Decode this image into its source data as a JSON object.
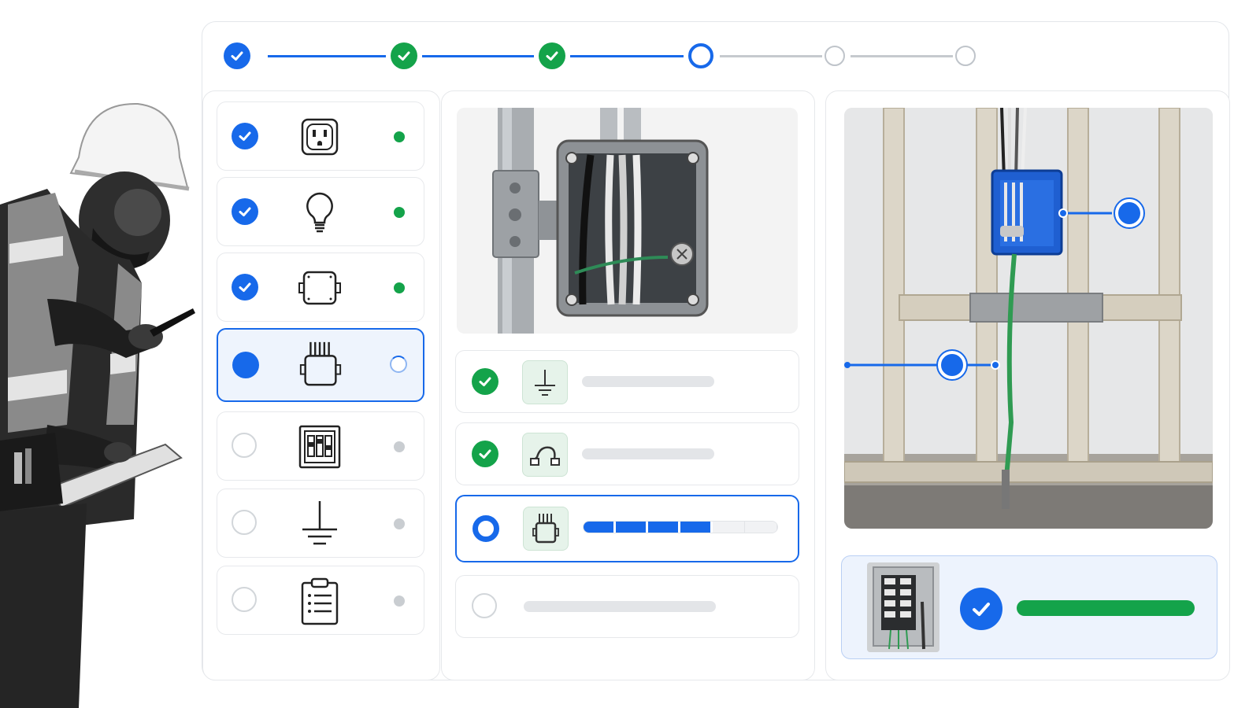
{
  "stepper": {
    "steps": [
      {
        "state": "complete",
        "color": "#1769ea"
      },
      {
        "state": "complete",
        "color": "#14a34a"
      },
      {
        "state": "complete",
        "color": "#14a34a"
      },
      {
        "state": "current",
        "color": "#1769ea"
      },
      {
        "state": "upcoming",
        "color": "#bfc4ca"
      },
      {
        "state": "upcoming",
        "color": "#bfc4ca"
      }
    ]
  },
  "task_list": {
    "items": [
      {
        "icon": "outlet-icon",
        "checked": true,
        "status": "complete"
      },
      {
        "icon": "light-bulb-icon",
        "checked": true,
        "status": "complete"
      },
      {
        "icon": "junction-box-icon",
        "checked": true,
        "status": "complete"
      },
      {
        "icon": "junction-box-wires-icon",
        "checked": false,
        "status": "in-progress",
        "selected": true
      },
      {
        "icon": "breaker-panel-icon",
        "checked": false,
        "status": "pending"
      },
      {
        "icon": "ground-icon",
        "checked": false,
        "status": "pending"
      },
      {
        "icon": "clipboard-icon",
        "checked": false,
        "status": "pending"
      }
    ]
  },
  "checklist": {
    "items": [
      {
        "icon": "ground-icon",
        "state": "complete"
      },
      {
        "icon": "conduit-strap-icon",
        "state": "complete"
      },
      {
        "icon": "junction-box-wires-icon",
        "state": "in-progress",
        "progress": 0.68
      },
      {
        "icon": "",
        "state": "pending"
      }
    ]
  },
  "completion": {
    "state": "complete",
    "icon": "breaker-panel-photo"
  },
  "colors": {
    "accent": "#1769ea",
    "success": "#14a34a",
    "muted": "#c9cdd1"
  }
}
